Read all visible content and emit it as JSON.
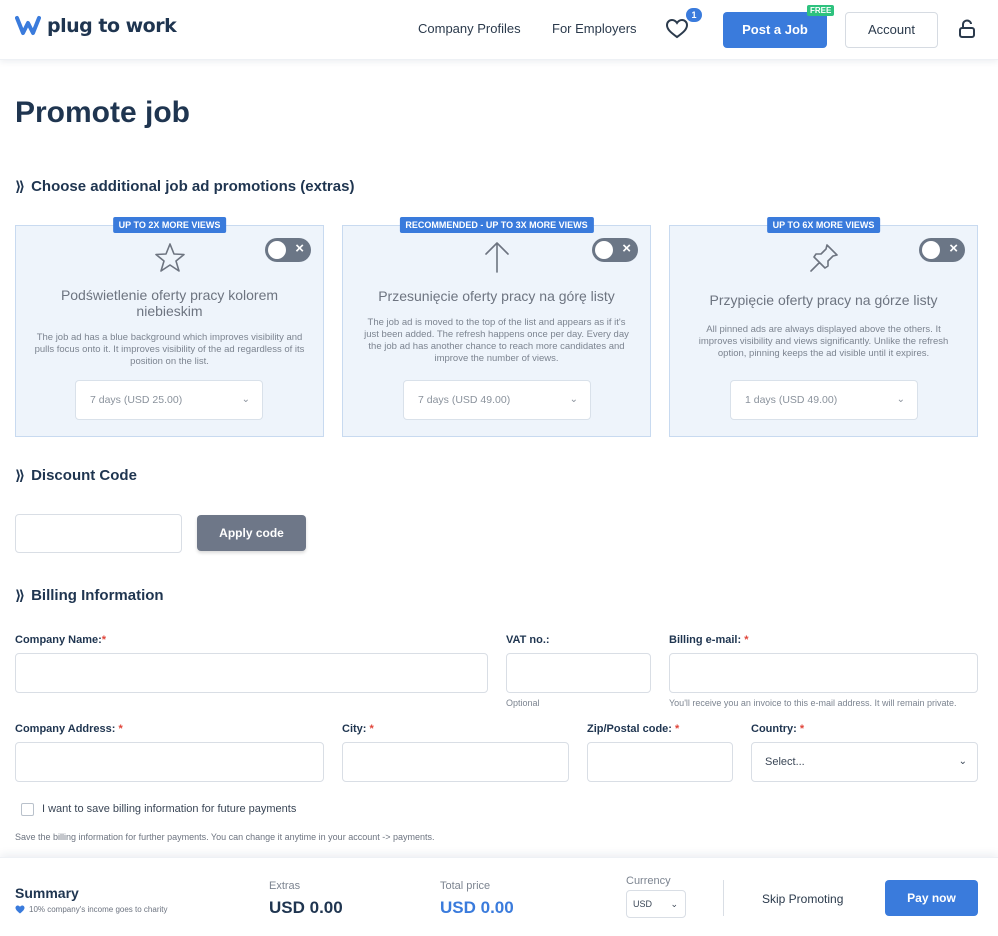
{
  "header": {
    "logo_text": "plug to work",
    "nav": [
      "Company Profiles",
      "For Employers"
    ],
    "favorites_count": "1",
    "post_job_label": "Post a Job",
    "free_badge": "FREE",
    "account_label": "Account"
  },
  "page_title": "Promote job",
  "promotions": {
    "section_title": "Choose additional job ad promotions (extras)",
    "cards": [
      {
        "badge": "UP TO 2X MORE VIEWS",
        "icon": "star-icon",
        "title": "Podświetlenie oferty pracy kolorem niebieskim",
        "description": "The job ad has a blue background which improves visibility and pulls focus onto it. It improves visibility of the ad regardless of its position on the list.",
        "selected_option": "7 days (USD 25.00)",
        "enabled": false
      },
      {
        "badge": "RECOMMENDED - UP TO 3X MORE VIEWS",
        "icon": "arrow-up-icon",
        "title": "Przesunięcie oferty pracy na górę listy",
        "description": "The job ad is moved to the top of the list and appears as if it's just been added. The refresh happens once per day. Every day the job ad has another chance to reach more candidates and improve the number of views.",
        "selected_option": "7 days (USD 49.00)",
        "enabled": false
      },
      {
        "badge": "UP TO 6X MORE VIEWS",
        "icon": "pin-icon",
        "title": "Przypięcie oferty pracy na górze listy",
        "description": "All pinned ads are always displayed above the others. It improves visibility and views significantly. Unlike the refresh option, pinning keeps the ad visible until it expires.",
        "selected_option": "1 days (USD 49.00)",
        "enabled": false
      }
    ]
  },
  "discount": {
    "section_title": "Discount Code",
    "input_value": "",
    "apply_label": "Apply code"
  },
  "billing": {
    "section_title": "Billing Information",
    "company_name_label": "Company Name:",
    "vat_label": "VAT no.:",
    "vat_hint": "Optional",
    "email_label": "Billing e-mail:",
    "email_hint": "You'll receive you an invoice to this e-mail address. It will remain private.",
    "address_label": "Company Address:",
    "city_label": "City:",
    "zip_label": "Zip/Postal code:",
    "country_label": "Country:",
    "country_value": "Select...",
    "required_mark": "*",
    "save_checkbox_label": "I want to save billing information for future payments",
    "save_checkbox_checked": false,
    "save_note": "Save the billing information for further payments. You can change it anytime in your account -> payments."
  },
  "summary": {
    "title": "Summary",
    "charity_note": "10% company's income goes to charity",
    "extras_label": "Extras",
    "extras_value": "USD 0.00",
    "total_label": "Total price",
    "total_value": "USD 0.00",
    "currency_label": "Currency",
    "currency_value": "USD",
    "skip_label": "Skip Promoting",
    "pay_label": "Pay now"
  },
  "colors": {
    "accent": "#3a7bdc",
    "heading": "#1f3550",
    "card_bg": "#eef4fb",
    "required": "#e0453a",
    "success_badge": "#2ec27e"
  }
}
